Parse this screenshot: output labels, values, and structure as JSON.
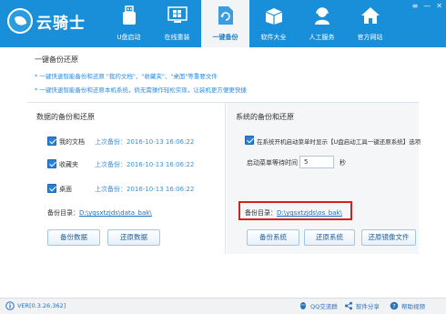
{
  "app": {
    "logo_text": "云骑士",
    "window_controls": [
      "≡",
      "—",
      "✕"
    ]
  },
  "nav": {
    "items": [
      {
        "label": "U盘启动",
        "icon": "usb-icon"
      },
      {
        "label": "在线重装",
        "icon": "windows-icon"
      },
      {
        "label": "一键备份",
        "icon": "backup-refresh-icon",
        "active": true
      },
      {
        "label": "软件大全",
        "icon": "software-box-icon"
      },
      {
        "label": "人工服务",
        "icon": "support-icon"
      },
      {
        "label": "官方网站",
        "icon": "home-icon"
      }
    ]
  },
  "intro": {
    "title": "一键备份还原",
    "lines": [
      "* 一键快速智能备份和还原 \"我的文档\"、\"收藏夹\"、\"桌面\"等重要文件",
      "* 一键快速智能备份和还原本机系统，倘无需操作轻松实现，让装机更方便更快捷"
    ]
  },
  "data_backup": {
    "title": "数据的备份和还原",
    "items": [
      {
        "label": "我的文档",
        "last_backup": "上次备份：2016-10-13 16:06:22",
        "checked": true
      },
      {
        "label": "收藏夹",
        "last_backup": "上次备份：2016-10-13 16:06:22",
        "checked": true
      },
      {
        "label": "桌面",
        "last_backup": "上次备份：2016-10-13 16:06:22",
        "checked": true
      }
    ],
    "dir_label": "备份目录：",
    "dir_value": "D:\\yqsxtzjds\\data_bak\\",
    "backup_button": "备份数据",
    "restore_button": "还原数据"
  },
  "system_backup": {
    "title": "系统的备份和还原",
    "option_label": "在系统开机启动菜单时显示【U盘启动工具一键还原系统】选项",
    "option_checked": true,
    "wait_label": "启动菜单等待时间",
    "wait_value": "5",
    "wait_unit": "秒",
    "dir_label": "备份目录：",
    "dir_value": "D:\\yqsxtzjds\\os_bak\\",
    "backup_button": "备份系统",
    "restore_button": "还原系统",
    "restore_image_button": "还原镜像文件"
  },
  "status": {
    "version": "VER[0.3.26.362]",
    "qq": "QQ交流群",
    "share": "软件分享",
    "help": "帮助视频"
  },
  "colors": {
    "topbar": "#1a8fd9",
    "accent": "#2a8be0",
    "highlight_box": "#d62020"
  }
}
